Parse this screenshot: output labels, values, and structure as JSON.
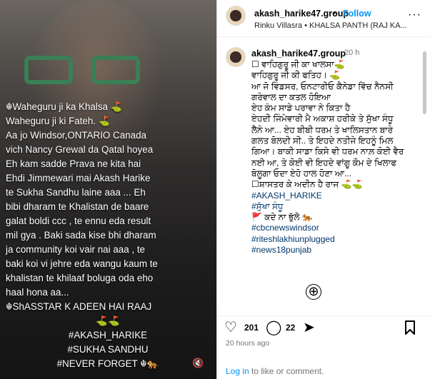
{
  "video": {
    "lines": [
      "☬Waheguru ji ka Khalsa ⛳",
      "Waheguru ji ki Fateh. ⛳",
      "Aa jo Windsor,ONTARIO Canada",
      "vich Nancy Grewal da Qatal hoyea",
      "Eh kam sadde Prava ne kita hai",
      "Ehdi Jimmewari mai Akash Harike",
      "te Sukha Sandhu laine aaa ... Eh",
      "bibi dharam te Khalistan de baare",
      "galat boldi ccc , te ennu eda result",
      "mil gya . Baki sada kise bhi dharam",
      "ja community koi vair nai aaa , te",
      "baki koi vi jehre eda wangu kaum te",
      "khalistan te khilaaf boluga oda eho",
      "haal hona aa...",
      "☬ShASSTAR K ADEEN HAI RAAJ",
      "⛳⛳",
      "#AKASH_HARIKE",
      "#SUKHA SANDHU",
      "#NEVER FORGET ☬🐅"
    ],
    "mute_icon": "🔇"
  },
  "header": {
    "username": "akash_harike47.group",
    "dot": "•",
    "follow_label": "Follow",
    "subtitle": "Rinku Villasra • KHALSA PANTH (RAJ KA...",
    "more_label": "···"
  },
  "caption": {
    "username": "akash_harike47.group",
    "time": "20 h",
    "lines": [
      "☐ ਵਾਹਿਗੁਰੂ ਜੀ ਕਾ ਖਾਲਸਾ⛳",
      "ਵਾਹਿਗੁਰੂ ਜੀ ਕੀ ਫਤਿਹ। ⛳",
      "ਆ ਜੋ ਵਿੰਡਸਰ, ਓਨਟਾਰੀਓ ਕੈਨੇਡਾ ਵਿੱਚ ਨੈਨਸੀ",
      "ਗਰੇਵਾਲ ਦਾ ਕਤਲ ਹੋਇਆ",
      "ਏਹ ਕੰਮ ਸਾਡੇ ਪਰਾਵਾ ਨੇ  ਕਿਤਾ ਹੈ",
      "ਏਹਦੀ ਜਿੰਮੇਵਾਰੀ ਮੈ ਅਕਾਸ਼ ਹਰੀਕੇ ਤੇ ਸੁੱਖਾ ਸੰਧੂ",
      "ਲੈਨੇ ਆ... ਏਹ ਬੀਬੀ ਧਰਮ ਤੇ ਖਾਲਿਸਤਾਨ  ਬਾਰੇ",
      "ਗਲਤ ਬੋਲਦੀ ਸੀ.. ਤੇ ਇਹਦੇ ਨਤੀਜੇ ਇਹਨੂੰ ਮਿਲ",
      "ਗਿਆ। ਬਾਕੀ ਸਾਡਾ ਕਿਸੇ ਵੀ ਧਰਮ ਨਾਲ਼ ਕੋਈ ਵੈਰ",
      "ਨਈ ਆ, ਤੇ ਕੋਈ ਵੀ  ਇਹਦੇ ਵਾਂਗੂ ਕੌਮ  ਦੇ ਖਿਲਾਫ",
      "ਬੋਲੂਗਾ ਓਦਾ ਏਹੋ ਹਾਲ ਹੋਣਾ ਆ...",
      "☐ਸ਼ਾਸਤਰ ਕੇ ਅਦੀਨ ਹੈ ਰਾਜ ⛳⛳"
    ],
    "tags": [
      "#AKASH_HARIKE",
      "#ਸੁੱਖਾ ਸੰਧੂ",
      "🚩 ਕਦੇ ਨਾ ਭੁੱਲੋ 🐅",
      "#cbcnewswindsor",
      "#riteshlakhiunplugged",
      "#news18punjab"
    ],
    "more_comments_icon": "⊕"
  },
  "actions": {
    "likes": "201",
    "comments": "22",
    "posted": "20 hours ago",
    "login_link": "Log in",
    "login_text": " to like or comment."
  }
}
